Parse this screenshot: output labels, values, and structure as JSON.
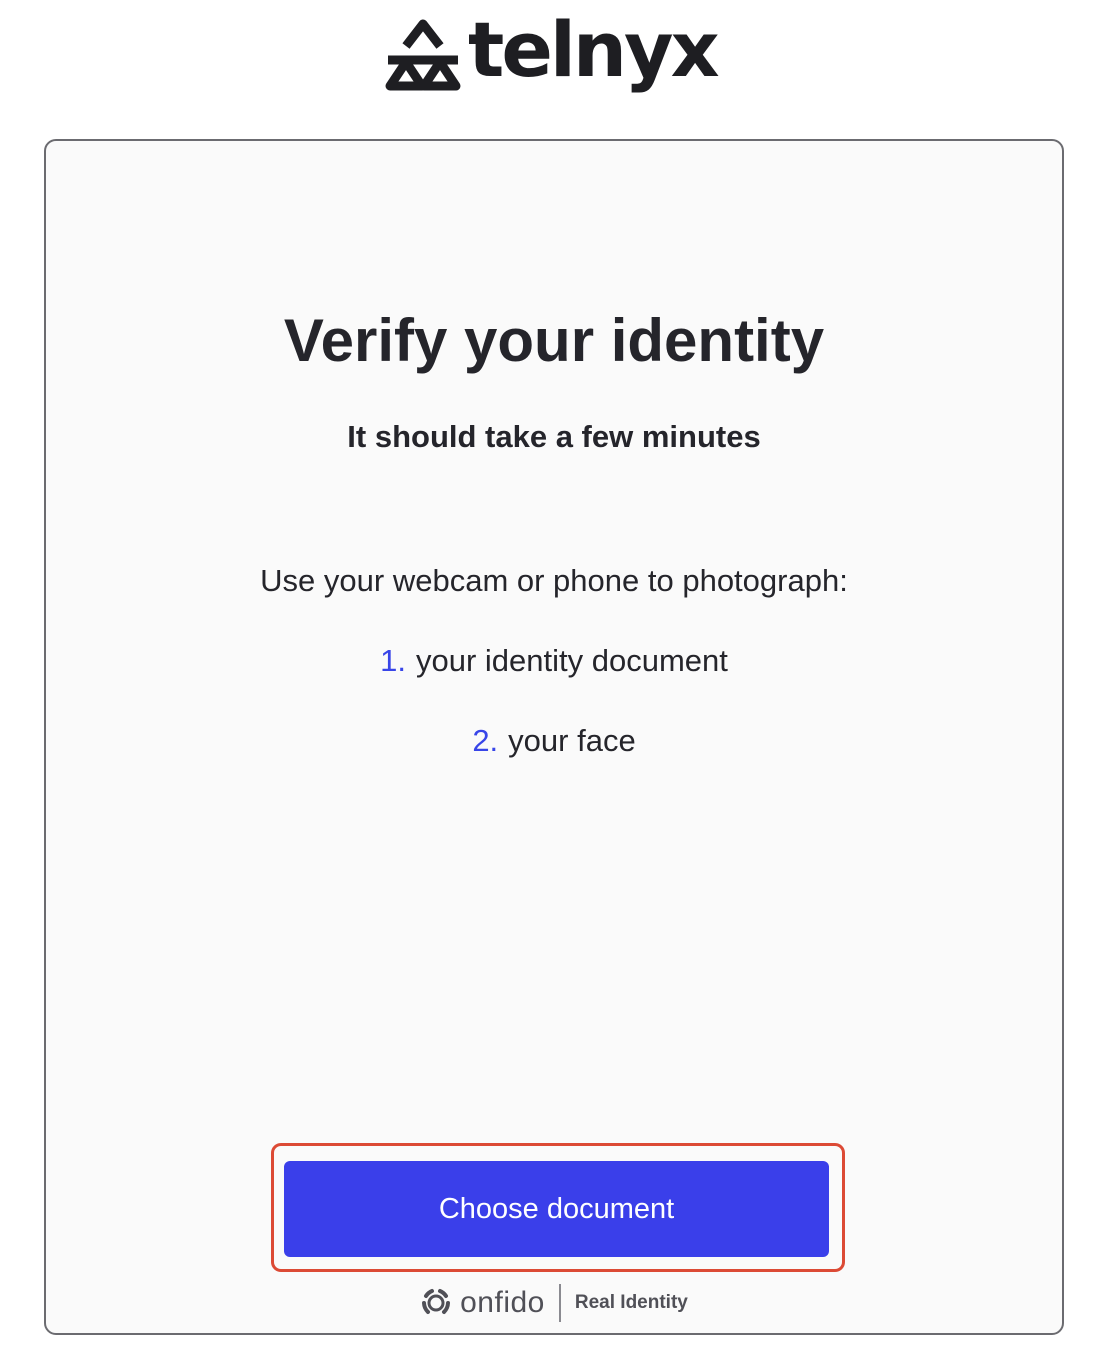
{
  "brand": {
    "name": "telnyx"
  },
  "card": {
    "title": "Verify your identity",
    "subtitle": "It should take a few minutes",
    "intro": "Use your webcam or phone to photograph:",
    "steps": [
      {
        "number": "1.",
        "label": "your identity document"
      },
      {
        "number": "2.",
        "label": "your face"
      }
    ],
    "primary_button": "Choose document",
    "footer": {
      "provider": "onfido",
      "tagline": "Real Identity"
    }
  },
  "colors": {
    "accent": "#3a3fea",
    "focus_ring": "#dc4a35",
    "text": "#25252b",
    "card_background": "#fafafa"
  },
  "icons": {
    "brand_mark": "telnyx-logo-icon",
    "provider_mark": "onfido-logo-icon"
  }
}
